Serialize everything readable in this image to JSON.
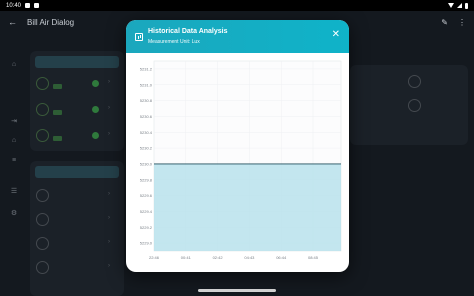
{
  "status_bar": {
    "time": "10:40"
  },
  "app": {
    "title": "Bill Air Dialog",
    "rail": [
      "",
      "",
      "",
      "",
      "",
      ""
    ],
    "left_panel_head": "",
    "left_panel2_head": "",
    "devices": [
      "",
      "",
      "",
      ""
    ]
  },
  "dialog": {
    "title": "Historical Data Analysis",
    "subtitle": "Measurement Unit: Lux",
    "close_icon": "close-icon",
    "chart_icon": "bar-chart-icon",
    "accent": "#14acc2"
  },
  "chart_data": {
    "type": "area",
    "title": "",
    "xlabel": "",
    "ylabel": "",
    "ylim": [
      5228.9,
      5231.3
    ],
    "y_ticks": [
      "5231.2",
      "5231.0",
      "5230.8",
      "5230.6",
      "5230.4",
      "5230.2",
      "5230.0",
      "5229.8",
      "5229.6",
      "5229.4",
      "5229.2",
      "5229.0"
    ],
    "x_ticks": [
      "22:46",
      "00:41",
      "02:42",
      "04:43",
      "06:44",
      "08:45"
    ],
    "series": [
      {
        "values": [
          5230.0,
          5230.0,
          5230.0,
          5230.0,
          5230.0,
          5230.0,
          5230.0
        ]
      }
    ],
    "line_color": "#1f4e5b",
    "fill_color": "#b8e2ec",
    "grid": true
  }
}
